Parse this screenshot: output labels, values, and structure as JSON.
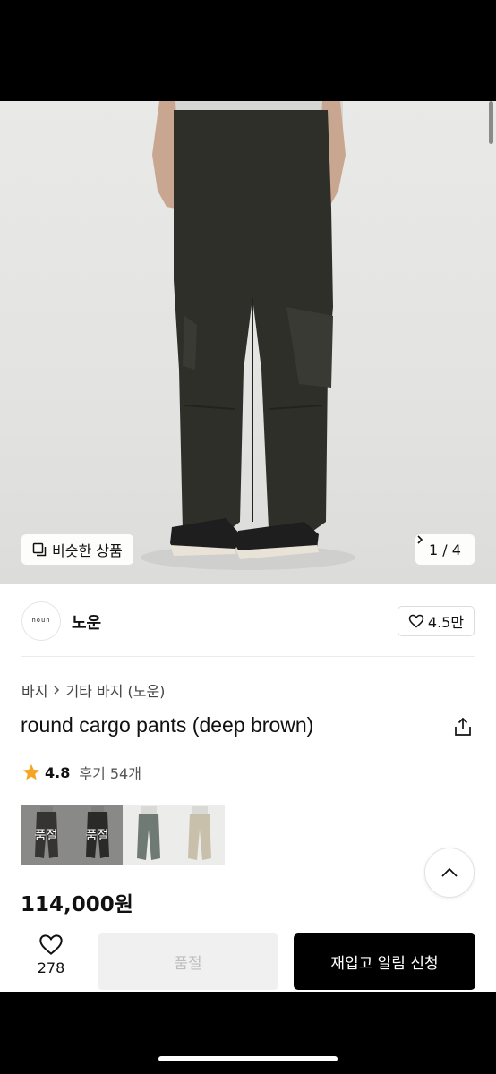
{
  "hero": {
    "similar_label": "비슷한 상품",
    "pager_text": "1 / 4"
  },
  "brand": {
    "logo_text": "noun",
    "name": "노운",
    "likes": "4.5만"
  },
  "breadcrumb": {
    "items": [
      "바지",
      "기타 바지 (노운)"
    ]
  },
  "product": {
    "title": "round cargo pants (deep brown)",
    "rating": "4.8",
    "review_link": "후기 54개",
    "price": "114,000원"
  },
  "thumbs": [
    {
      "badge": "품절",
      "color": "#2d2c28"
    },
    {
      "badge": "품절",
      "color": "#151513"
    },
    {
      "badge": "",
      "color": "#6f7a74"
    },
    {
      "badge": "",
      "color": "#c9c0ac"
    }
  ],
  "bottom_bar": {
    "wishlist_count": "278",
    "soldout_label": "품절",
    "restock_label": "재입고 알림 신청"
  },
  "colors": {
    "star": "#f5a524",
    "primary_button": "#000000",
    "disabled_button": "#f0f0f0"
  }
}
